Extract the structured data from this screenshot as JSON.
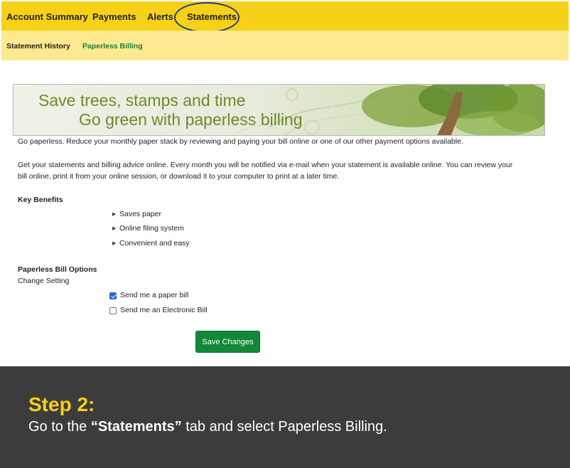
{
  "top_nav": {
    "tabs": [
      {
        "label": "Account Summary"
      },
      {
        "label": "Payments"
      },
      {
        "label": "Alerts"
      },
      {
        "label": "Statements"
      }
    ]
  },
  "sub_nav": {
    "items": [
      {
        "label": "Statement History"
      },
      {
        "label": "Paperless Billing"
      }
    ]
  },
  "banner": {
    "line1": "Save trees, stamps and time",
    "line2": "Go green with paperless billing"
  },
  "content": {
    "intro": "Go paperless. Reduce your monthly paper stack by reviewing and paying your bill online or one of our other payment options available.",
    "description_line1": "Get your statements and billing advice online. Every month you will be notified via e-mail when your statement is available online. You can review your",
    "description_line2": "bill online, print it from your online session, or download it to your computer to print at a later time.",
    "benefits_heading": "Key Benefits",
    "benefits": [
      "Saves paper",
      "Online filing system",
      "Convenient and easy"
    ],
    "options_heading": "Paperless Bill Options",
    "change_setting": "Change Setting",
    "options": [
      {
        "label": "Send me a paper bill",
        "checked": true
      },
      {
        "label": "Send me an Electronic Bill",
        "checked": false
      }
    ],
    "save_label": "Save Changes"
  },
  "caption": {
    "step": "Step 2:",
    "text_before": "Go to the ",
    "text_bold": "“Statements”",
    "text_after": " tab and select Paperless Billing."
  },
  "colors": {
    "nav_yellow": "#f7d117",
    "subnav_yellow": "#fde98f",
    "active_green": "#1f7a3a",
    "button_green": "#13883a",
    "step_yellow": "#f8cf17",
    "caption_bg": "#3c3c3c"
  }
}
